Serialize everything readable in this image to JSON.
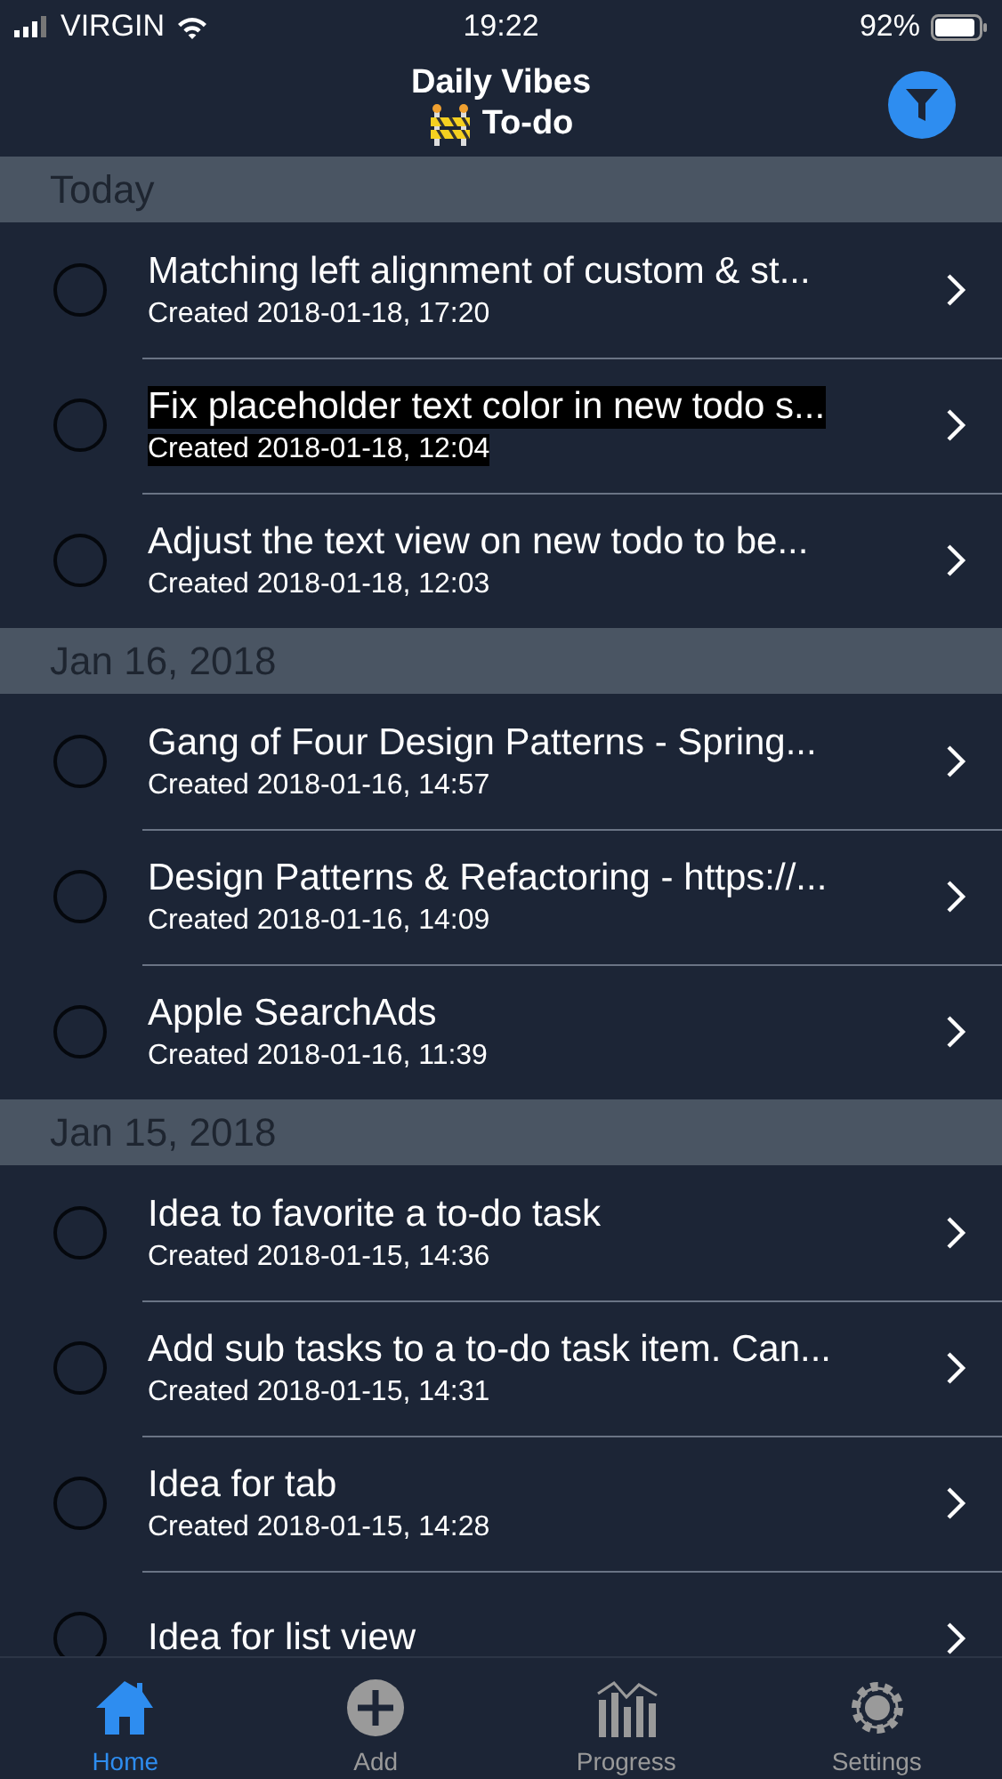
{
  "status_bar": {
    "carrier": "VIRGIN",
    "time": "19:22",
    "battery": "92%"
  },
  "nav": {
    "app_title": "Daily Vibes",
    "subtitle": "To-do"
  },
  "sections": [
    {
      "header": "Today",
      "items": [
        {
          "title": "Matching left alignment of custom & st...",
          "created": "Created 2018-01-18, 17:20",
          "highlighted": false
        },
        {
          "title": "Fix placeholder text color in new todo s...",
          "created": "Created 2018-01-18, 12:04",
          "highlighted": true
        },
        {
          "title": "Adjust the text view on new todo to be...",
          "created": "Created 2018-01-18, 12:03",
          "highlighted": false
        }
      ]
    },
    {
      "header": "Jan 16, 2018",
      "items": [
        {
          "title": "Gang of Four Design Patterns - Spring...",
          "created": "Created 2018-01-16, 14:57",
          "highlighted": false
        },
        {
          "title": "Design Patterns & Refactoring - https://...",
          "created": "Created 2018-01-16, 14:09",
          "highlighted": false
        },
        {
          "title": "Apple SearchAds",
          "created": "Created 2018-01-16, 11:39",
          "highlighted": false
        }
      ]
    },
    {
      "header": "Jan 15, 2018",
      "items": [
        {
          "title": "Idea to favorite a to-do task",
          "created": "Created 2018-01-15, 14:36",
          "highlighted": false
        },
        {
          "title": "Add sub tasks to a to-do task item. Can...",
          "created": "Created 2018-01-15, 14:31",
          "highlighted": false
        },
        {
          "title": "Idea for tab",
          "created": "Created 2018-01-15, 14:28",
          "highlighted": false
        },
        {
          "title": "Idea for list view",
          "highlighted": false
        }
      ]
    }
  ],
  "tabs": [
    {
      "label": "Home",
      "kind": "home",
      "selected": true
    },
    {
      "label": "Add",
      "kind": "add",
      "selected": false
    },
    {
      "label": "Progress",
      "kind": "progress",
      "selected": false
    },
    {
      "label": "Settings",
      "kind": "settings",
      "selected": false
    }
  ]
}
